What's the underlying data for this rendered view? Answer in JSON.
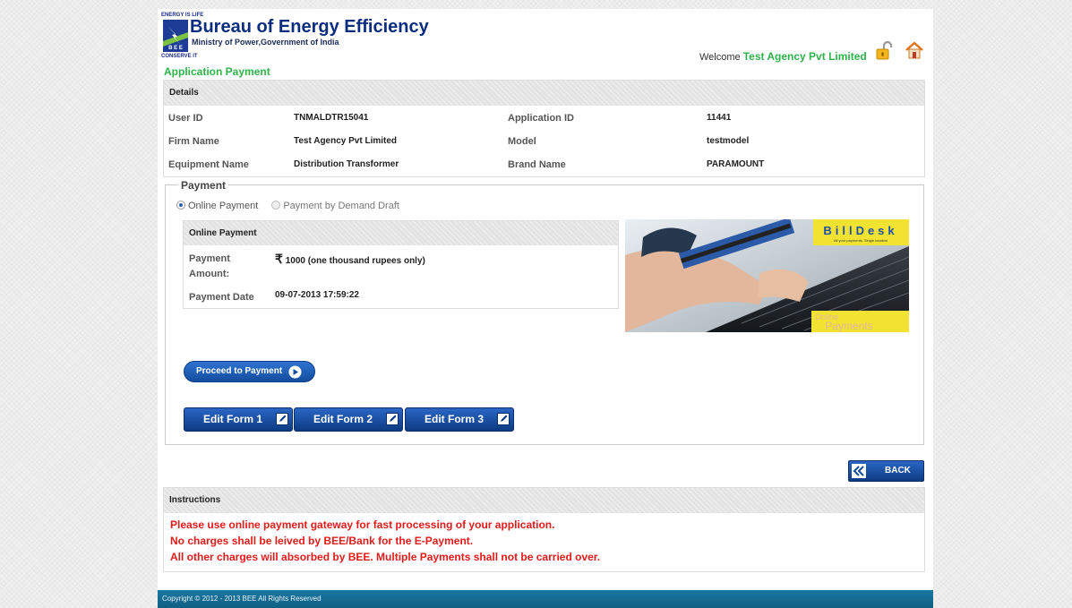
{
  "header": {
    "logo_top": "ENERGY IS LIFE",
    "logo_bottom": "CONSERVE IT",
    "org_name": "Bureau of Energy Efficiency",
    "org_sub": "Ministry of Power,Government of India",
    "welcome_label": "Welcome ",
    "user_name": "Test Agency Pvt Limited",
    "icons": [
      "lock-icon",
      "home-icon"
    ]
  },
  "page_title": "Application Payment",
  "details": {
    "heading": "Details",
    "rows": [
      {
        "label": "User ID",
        "value": "TNMALDTR15041",
        "label2": "Application ID",
        "value2": "11441"
      },
      {
        "label": "Firm Name",
        "value": "Test Agency Pvt Limited",
        "label2": "Model",
        "value2": "testmodel"
      },
      {
        "label": "Equipment Name",
        "value": "Distribution Transformer",
        "label2": "Brand Name",
        "value2": "PARAMOUNT"
      }
    ]
  },
  "payment": {
    "legend": "Payment",
    "options": [
      "Online Payment",
      "Payment by Demand Draft"
    ],
    "selected": "Online Payment",
    "online": {
      "heading": "Online Payment",
      "amount_label": "Payment Amount:",
      "amount_symbol": "₹",
      "amount_value": "1000 (one thousand rupees only)",
      "date_label": "Payment Date",
      "date_value": "09-07-2013 17:59:22"
    },
    "banner": {
      "brand": "BillDesk",
      "tagline": "All your payments. Single location",
      "caption_top": "Online",
      "caption_bottom": "Payments"
    },
    "proceed_label": "Proceed to Payment",
    "edit_buttons": [
      "Edit Form 1",
      "Edit Form 2",
      "Edit Form 3"
    ]
  },
  "back_label": "BACK",
  "instructions": {
    "heading": "Instructions",
    "lines": [
      "Please use online payment gateway for fast processing of your application.",
      "No charges shall be leived by BEE/Bank for the E-Payment.",
      "All other charges will absorbed by BEE. Multiple Payments shall not be carried over."
    ]
  },
  "footer": "Copyright © 2012 - 2013 BEE All Rights Reserved",
  "colors": {
    "accent_green": "#2fb24a",
    "button_blue": "#134d9e",
    "warning_red": "#e21b1b",
    "footer_teal": "#1c78a0"
  }
}
